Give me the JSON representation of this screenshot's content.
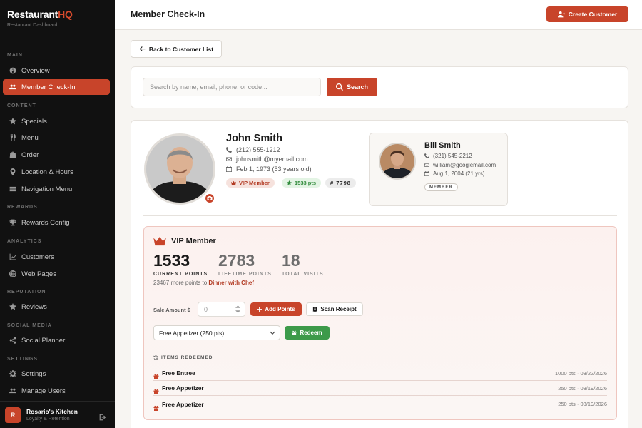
{
  "brand": {
    "name_main": "Restaurant",
    "name_accent": "HQ",
    "subtitle": "Restaurant Dashboard"
  },
  "sidebar": {
    "sections": [
      "MAIN",
      "CONTENT",
      "REWARDS",
      "ANALYTICS",
      "REPUTATION",
      "SOCIAL MEDIA",
      "SETTINGS"
    ],
    "items": [
      {
        "label": "Overview",
        "icon": "dashboard-icon"
      },
      {
        "label": "Member Check-In",
        "icon": "users-icon",
        "active": true
      },
      {
        "label": "Specials",
        "icon": "star-icon"
      },
      {
        "label": "Menu",
        "icon": "utensils-icon"
      },
      {
        "label": "Order",
        "icon": "bag-icon"
      },
      {
        "label": "Location & Hours",
        "icon": "map-pin-icon"
      },
      {
        "label": "Navigation Menu",
        "icon": "bars-icon"
      },
      {
        "label": "Rewards Config",
        "icon": "trophy-icon"
      },
      {
        "label": "Customers",
        "icon": "chart-line-icon"
      },
      {
        "label": "Web Pages",
        "icon": "globe-icon"
      },
      {
        "label": "Reviews",
        "icon": "star-icon"
      },
      {
        "label": "Social Planner",
        "icon": "share-icon"
      },
      {
        "label": "Settings",
        "icon": "gear-icon"
      },
      {
        "label": "Manage Users",
        "icon": "users-icon"
      }
    ],
    "footer": {
      "initial": "R",
      "name": "Rosario's Kitchen",
      "subtitle": "Loyalty & Retention"
    }
  },
  "header": {
    "title": "Member Check-In",
    "create_label": "Create Customer"
  },
  "back_label": "Back to Customer List",
  "search": {
    "placeholder": "Search by name, email, phone, or code...",
    "button_label": "Search"
  },
  "customer": {
    "name": "John Smith",
    "phone": "(212) 555-1212",
    "email": "johnsmith@myemail.com",
    "birthday": "Feb 1, 1973 (53 years old)",
    "badge_vip": "VIP Member",
    "badge_points": "1533 pts",
    "badge_code": "# 7798"
  },
  "family_member": {
    "name": "Bill Smith",
    "phone": "(321) 545-2212",
    "email": "william@googlemail.com",
    "birthday": "Aug 1, 2004 (21 yrs)",
    "badge": "MEMBER"
  },
  "vip": {
    "title": "VIP Member",
    "stats": [
      {
        "value": "1533",
        "label": "CURRENT POINTS"
      },
      {
        "value": "2783",
        "label": "LIFETIME POINTS"
      },
      {
        "value": "18",
        "label": "TOTAL VISITS"
      }
    ],
    "progress_prefix": "23467 more points to",
    "progress_reward": "Dinner with Chef",
    "sale_label": "Sale Amount $",
    "sale_placeholder": "0",
    "add_points_label": "Add Points",
    "scan_receipt_label": "Scan Receipt",
    "reward_selected": "Free Appetizer (250 pts)",
    "redeem_label": "Redeem",
    "items_header": "ITEMS REDEEMED",
    "items": [
      {
        "name": "Free Entree",
        "meta": "1000 pts · 03/22/2026"
      },
      {
        "name": "Free Appetizer",
        "meta": "250 pts · 03/19/2026"
      },
      {
        "name": "Free Appetizer",
        "meta": "250 pts · 03/19/2026"
      }
    ]
  },
  "colors": {
    "accent": "#c8442a",
    "sidebar_bg": "#111111",
    "success": "#3d9a4a"
  }
}
